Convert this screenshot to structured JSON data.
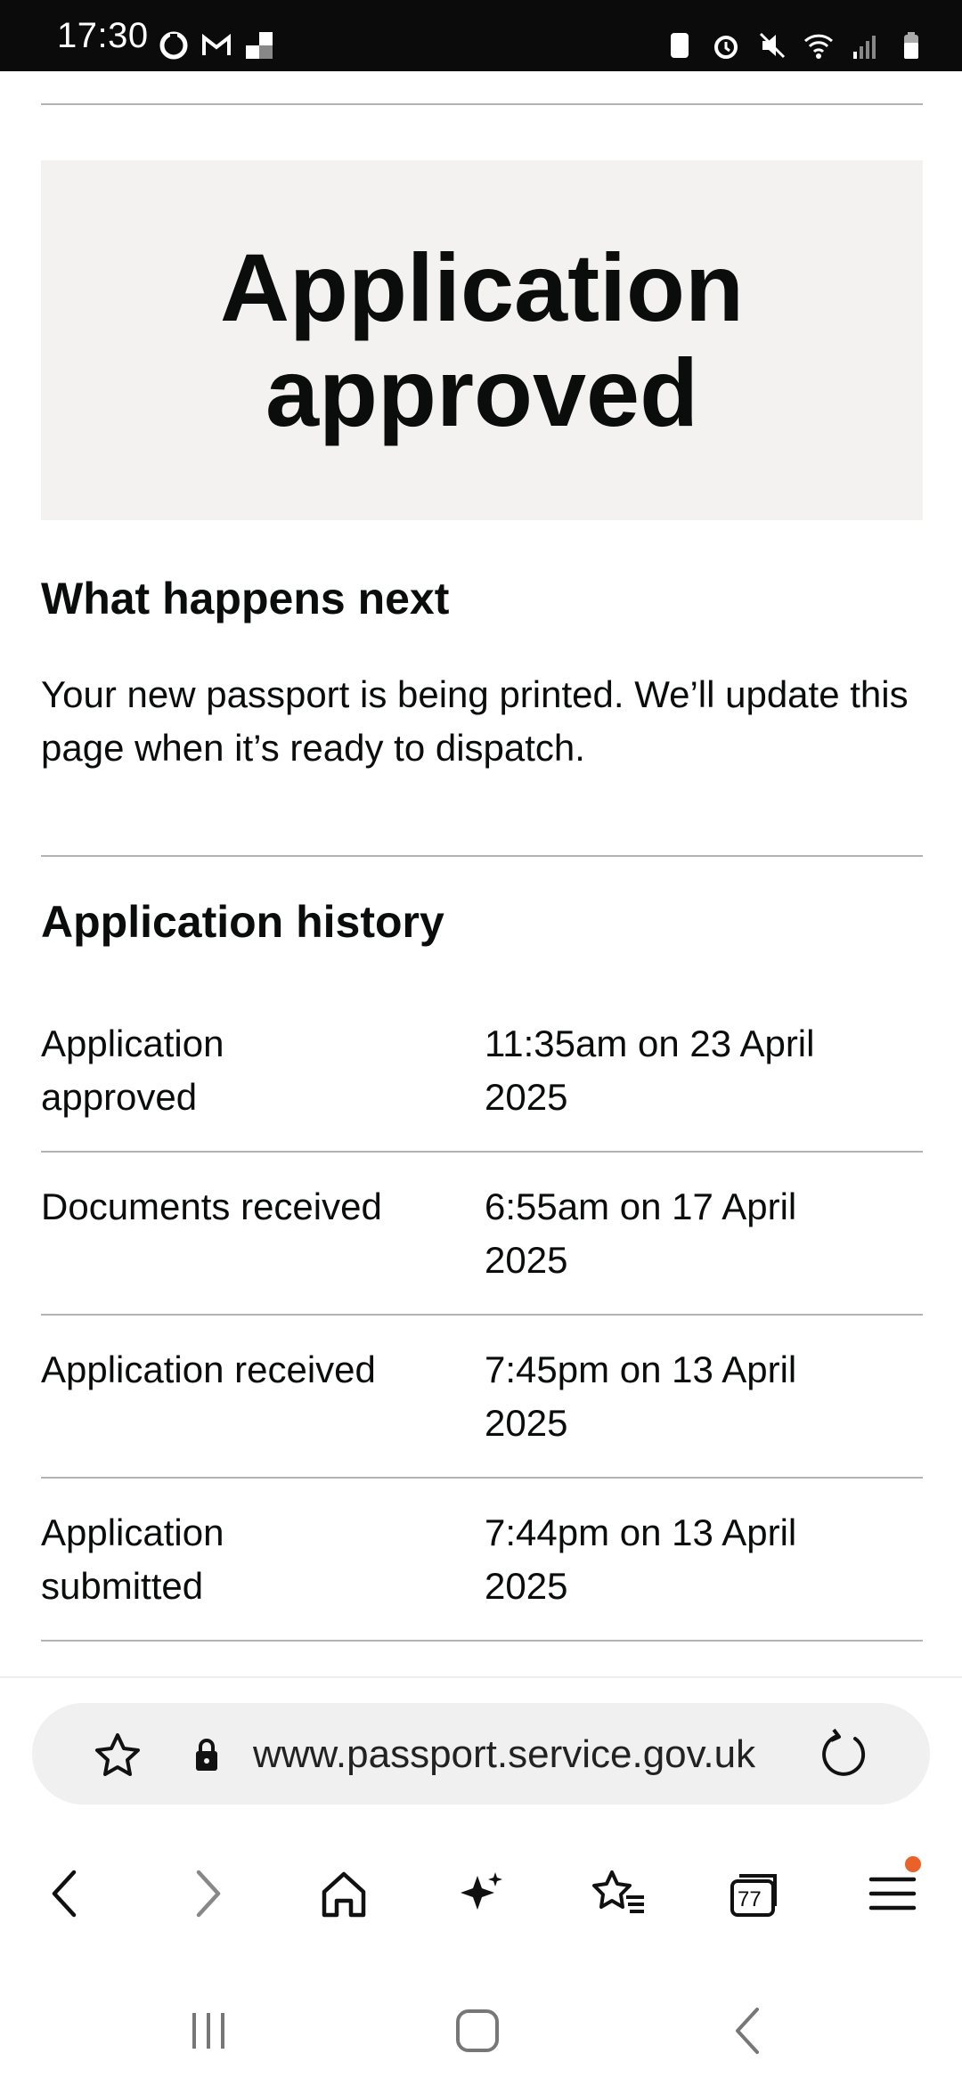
{
  "status_bar": {
    "time": "17:30",
    "left_icons": [
      "sync-icon",
      "gmail-icon",
      "news-icon"
    ],
    "right_icons": [
      "battery-saver-icon",
      "alarm-icon",
      "mute-icon",
      "wifi-icon",
      "signal-icon",
      "battery-icon"
    ]
  },
  "page": {
    "panel_title": "Application approved",
    "next_heading": "What happens next",
    "next_text": "Your new passport is being printed. We’ll update this page when it’s ready to dispatch.",
    "history_heading": "Application history",
    "history": [
      {
        "event": "Application approved",
        "when": "11:35am on 23 April 2025"
      },
      {
        "event": "Documents received",
        "when": "6:55am on 17 April 2025"
      },
      {
        "event": "Application received",
        "when": "7:45pm on 13 April 2025"
      },
      {
        "event": "Application submitted",
        "when": "7:44pm on 13 April 2025"
      }
    ]
  },
  "browser": {
    "url": "www.passport.service.gov.uk",
    "tabs_count": "77",
    "nav_icons": [
      "back-icon",
      "forward-icon",
      "home-icon",
      "ai-sparkle-icon",
      "bookmarks-icon",
      "tabs-icon",
      "menu-icon"
    ],
    "accent_dot_color": "#e8622a"
  },
  "system_nav": [
    "recents-icon",
    "home-button-icon",
    "back-gesture-icon"
  ]
}
